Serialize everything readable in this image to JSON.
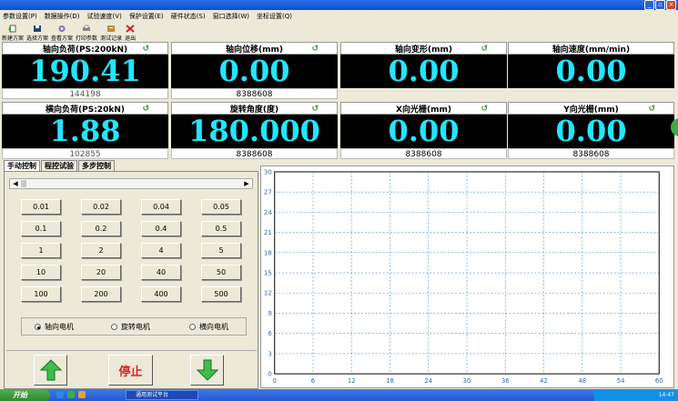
{
  "menu": [
    "参数设置(P)",
    "数据操作(D)",
    "试验速度(V)",
    "保护设置(E)",
    "硬件状态(S)",
    "窗口选择(W)",
    "坐标设置(Q)"
  ],
  "toolbar": [
    "新建方案",
    "选择方案",
    "查看方案",
    "打印参数",
    "测试记录",
    "退出"
  ],
  "meters": [
    {
      "title": "轴向负荷(PS:200kN)",
      "value": "190.41",
      "raw": "144198"
    },
    {
      "title": "轴向位移(mm)",
      "value": "0.00",
      "raw": "8388608"
    },
    {
      "title": "轴向变形(mm)",
      "value": "0.00",
      "raw": ""
    },
    {
      "title": "轴向速度(mm/min)",
      "value": "0.00",
      "raw": ""
    },
    {
      "title": "横向负荷(PS:20kN)",
      "value": "1.88",
      "raw": "102855"
    },
    {
      "title": "旋转角度(度)",
      "value": "180.000",
      "raw": "8388608"
    },
    {
      "title": "X向光栅(mm)",
      "value": "0.00",
      "raw": "8388608"
    },
    {
      "title": "Y向光栅(mm)",
      "value": "0.00",
      "raw": "8388608"
    }
  ],
  "tabs": [
    "手动控制",
    "程控试验",
    "多步控制"
  ],
  "steps": [
    "0.01",
    "0.02",
    "0.04",
    "0.05",
    "0.1",
    "0.2",
    "0.4",
    "0.5",
    "1",
    "2",
    "4",
    "5",
    "10",
    "20",
    "40",
    "50",
    "100",
    "200",
    "400",
    "500"
  ],
  "motors": [
    {
      "label": "轴向电机",
      "selected": true
    },
    {
      "label": "旋转电机",
      "selected": false
    },
    {
      "label": "横向电机",
      "selected": false
    }
  ],
  "stop_label": "停止",
  "chart_data": {
    "type": "line",
    "x_ticks": [
      "0",
      "6",
      "12",
      "18",
      "24",
      "30",
      "36",
      "42",
      "48",
      "54",
      "60"
    ],
    "y_ticks": [
      "0",
      "3",
      "6",
      "9",
      "12",
      "15",
      "18",
      "21",
      "24",
      "27",
      "30"
    ],
    "xlim": [
      0,
      60
    ],
    "ylim": [
      0,
      30
    ],
    "grid": true,
    "series": []
  },
  "taskbar": {
    "start": "开始",
    "task": "通用测试平台",
    "clock": "14:47"
  }
}
